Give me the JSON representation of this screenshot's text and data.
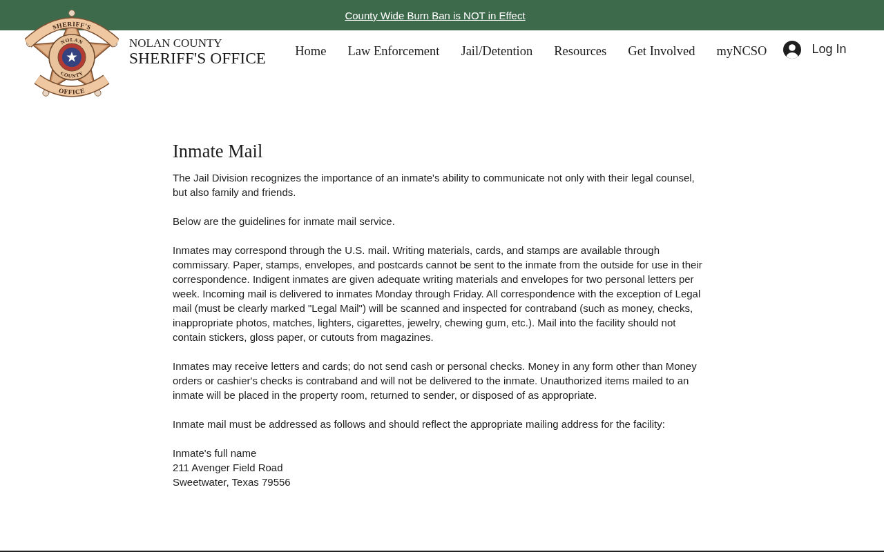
{
  "banner": {
    "link": "County Wide Burn Ban is NOT in Effect"
  },
  "header": {
    "logo": {
      "ribbon_top": "SHERIFF'S",
      "ring_top": "NOLAN",
      "ring_bottom": "COUNTY",
      "ribbon_bottom": "OFFICE"
    },
    "site_title": {
      "line_1": "NOLAN COUNTY",
      "line_2": "SHERIFF'S OFFICE"
    },
    "nav": [
      "Home",
      "Law Enforcement",
      "Jail/Detention",
      "Resources",
      "Get Involved",
      "myNCSO"
    ],
    "login": "Log In"
  },
  "content": {
    "title": "Inmate Mail",
    "paragraphs": [
      "The Jail Division recognizes the importance of an inmate's ability to communicate not only with their legal counsel, but also family and friends.",
      "Below are the guidelines for inmate mail service.",
      "Inmates may correspond through the U.S. mail. Writing materials, cards, and stamps are available through commissary. Paper, stamps, envelopes, and postcards cannot be sent to the inmate from the outside for use in their correspondence. Indigent inmates are given adequate writing materials and envelopes for two personal letters per week. Incoming mail is delivered to inmates Monday through Friday. All correspondence with the exception of Legal mail (must be clearly marked \"Legal Mail\") will be scanned and inspected for contraband (such as money, checks, inappropriate photos, matches, lighters, cigarettes, jewelry, chewing gum, etc.). Mail into the facility should not contain stickers, gloss paper, or cutouts from magazines.",
      "Inmates may receive letters and cards; do not send cash or personal checks. Money in any form other than Money orders or cashier's checks is contraband and will not be delivered to the inmate. Unauthorized items mailed to an inmate will be placed in the property room, returned to sender, or disposed of as appropriate.",
      "Inmate mail must be addressed as follows and should reflect the appropriate mailing address for the facility:"
    ],
    "address": [
      "Inmate's full name",
      "211 Avenger Field Road",
      "Sweetwater, Texas 79556"
    ]
  }
}
